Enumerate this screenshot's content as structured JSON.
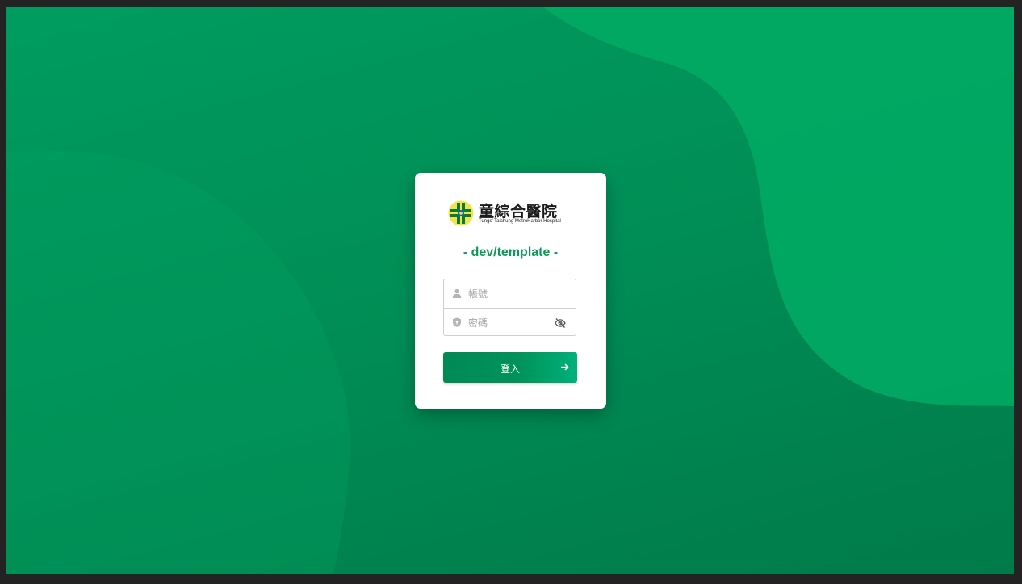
{
  "brand": {
    "name_cn": "童綜合醫院",
    "name_en": "Tungs' Taichung MetroHarbor Hospital"
  },
  "env_title": "- dev/template -",
  "form": {
    "username_placeholder": "帳號",
    "password_placeholder": "密碼",
    "login_label": "登入"
  },
  "icons": {
    "username": "user-icon",
    "password": "shield-icon",
    "toggle": "eye-off-icon",
    "submit": "arrow-right-icon"
  },
  "colors": {
    "accent": "#0d9a5a",
    "background": "#009c5f"
  }
}
